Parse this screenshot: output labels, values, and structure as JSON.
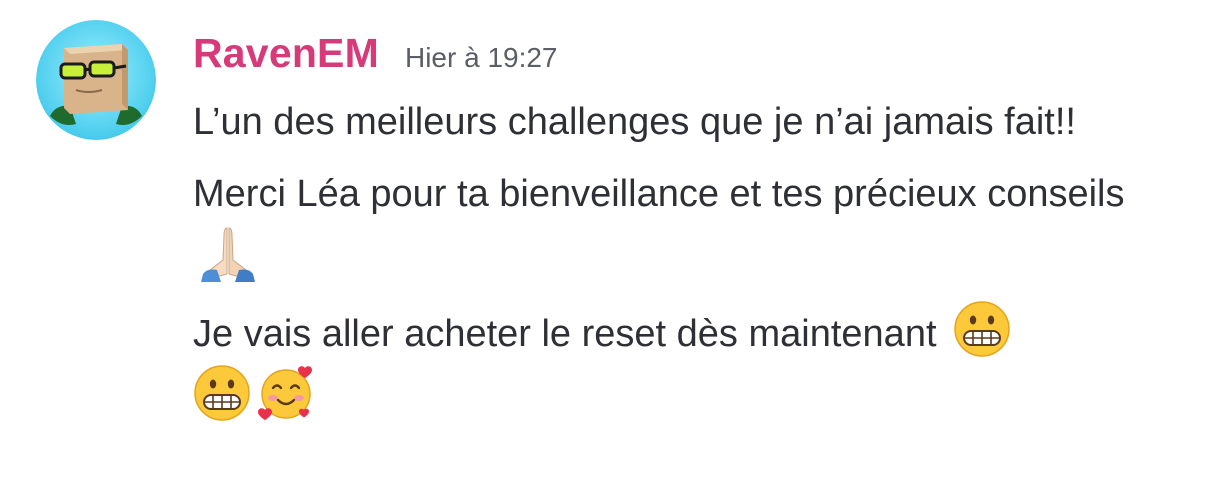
{
  "message": {
    "author": "RavenEM",
    "timestamp": "Hier à 19:27",
    "author_color": "#d63a78",
    "paragraphs": [
      {
        "text": "L’un des meilleurs challenges que je n’ai jamais fait!!",
        "emojis": []
      },
      {
        "text": "Merci Léa pour ta bienveillance et tes précieux conseils",
        "emojis": [
          "folded-hands-icon"
        ]
      },
      {
        "text": "Je vais aller acheter le reset dès maintenant",
        "emojis": [
          "grimacing-face-icon",
          "grimacing-face-icon",
          "smiling-face-with-hearts-icon"
        ]
      }
    ]
  }
}
